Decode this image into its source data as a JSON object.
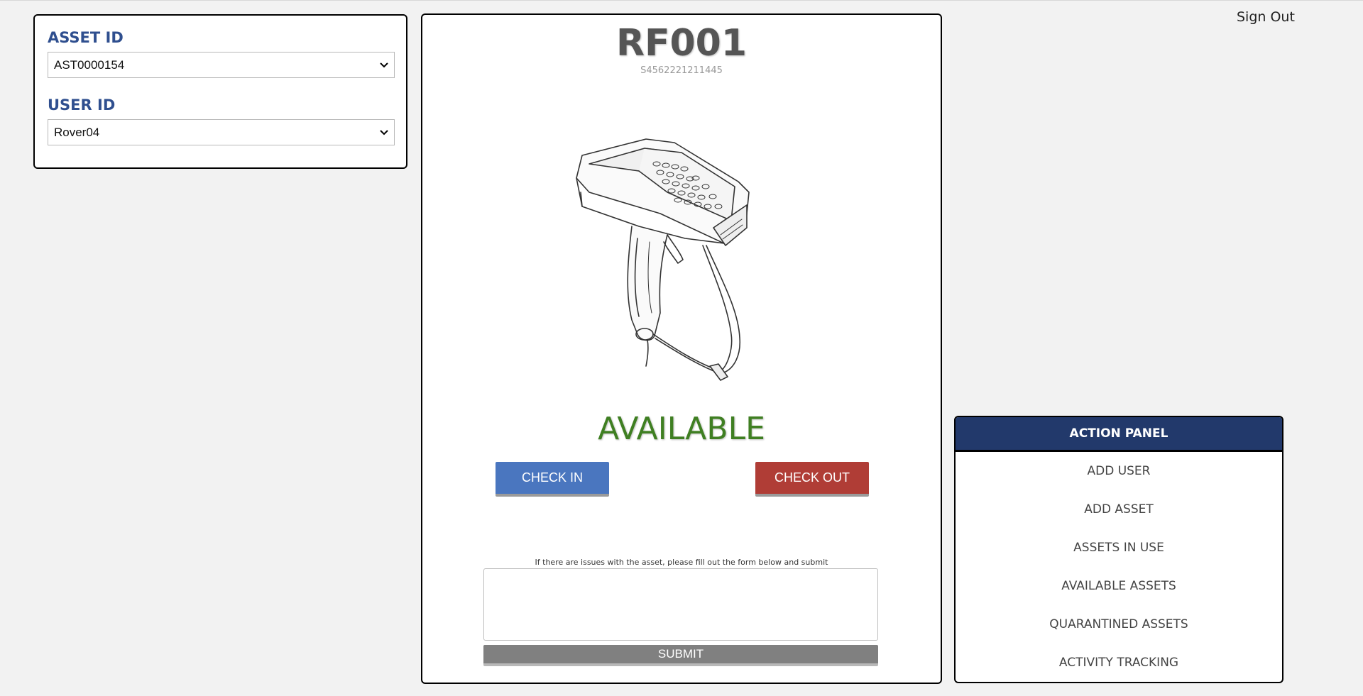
{
  "header": {
    "sign_out_label": "Sign Out"
  },
  "selectors": {
    "asset": {
      "label": "ASSET ID",
      "value": "AST0000154"
    },
    "user": {
      "label": "USER ID",
      "value": "Rover04"
    }
  },
  "asset_card": {
    "name": "RF001",
    "serial": "S4562221211445",
    "status": "AVAILABLE",
    "status_color": "#3f7f22",
    "image_icon": "handheld-scanner-illustration",
    "check_in_label": "CHECK IN",
    "check_out_label": "CHECK OUT",
    "issue_hint": "If there are issues with the asset, please fill out the form below and submit",
    "issue_text_value": "",
    "submit_label": "SUBMIT"
  },
  "action_panel": {
    "title": "ACTION PANEL",
    "items": [
      {
        "label": "ADD USER"
      },
      {
        "label": "ADD ASSET"
      },
      {
        "label": "ASSETS IN USE"
      },
      {
        "label": "AVAILABLE ASSETS"
      },
      {
        "label": "QUARANTINED ASSETS"
      },
      {
        "label": "ACTIVITY TRACKING"
      }
    ]
  },
  "colors": {
    "label_blue": "#2f4f8f",
    "check_in": "#4a76bf",
    "check_out": "#b03d36",
    "submit": "#808080",
    "panel_header": "#22396b"
  }
}
